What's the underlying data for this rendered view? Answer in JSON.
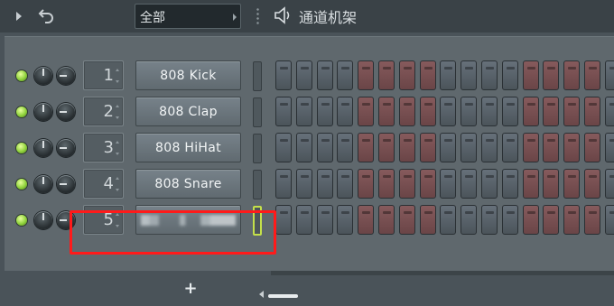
{
  "toolbar": {
    "filter_label": "全部",
    "title": "通道机架",
    "icons": [
      "play-icon",
      "undo-icon",
      "speaker-icon"
    ]
  },
  "channels": [
    {
      "number": "1",
      "name": "808 Kick",
      "steps": "ggggrrrrggggrrrrg"
    },
    {
      "number": "2",
      "name": "808 Clap",
      "steps": "ggggrrrrggggrrrrg"
    },
    {
      "number": "3",
      "name": "808 HiHat",
      "steps": "ggggrrrrggggrrrrg"
    },
    {
      "number": "4",
      "name": "808 Snare",
      "steps": "ggggrrrrggggrrrrg"
    },
    {
      "number": "5",
      "name": "",
      "name_obscured": true,
      "selected": true,
      "steps": "ggggrrrrggggrrrrg"
    }
  ],
  "footer": {
    "add_label": "+"
  },
  "colors": {
    "led": "#8fd23b",
    "step_grey": "#5a646b",
    "step_red": "#7a4f51",
    "highlight": "#ff1a1a",
    "selection": "#c4e04a"
  }
}
